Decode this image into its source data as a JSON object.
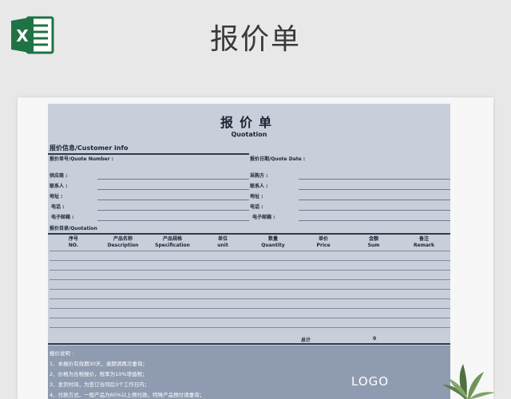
{
  "header": {
    "title": "报价单"
  },
  "doc": {
    "title": "报价单",
    "subtitle": "Quotation",
    "info_section": "报价信息/Customer info",
    "fields_left": [
      {
        "label": "报价单号/Quote Number :"
      },
      {
        "label": "供应商 :"
      },
      {
        "label": "联系人 :"
      },
      {
        "label": "地址 :"
      },
      {
        "label": "电话 :"
      },
      {
        "label": "电子邮箱 :"
      }
    ],
    "fields_right": [
      {
        "label": "报价日期/Quote Date :"
      },
      {
        "label": "采购方 :"
      },
      {
        "label": "联系人 :"
      },
      {
        "label": "地址 :"
      },
      {
        "label": "电话 :"
      },
      {
        "label": "电子邮箱 :"
      }
    ],
    "list_section": "报价目录/Quotation",
    "columns": [
      {
        "zh": "序号",
        "en": "NO."
      },
      {
        "zh": "产品名称",
        "en": "Description"
      },
      {
        "zh": "产品规格",
        "en": "Specification"
      },
      {
        "zh": "单位",
        "en": "unit"
      },
      {
        "zh": "数量",
        "en": "Quantity"
      },
      {
        "zh": "单价",
        "en": "Price"
      },
      {
        "zh": "金额",
        "en": "Sum"
      },
      {
        "zh": "备注",
        "en": "Remark"
      }
    ],
    "total_label": "总计",
    "total_value": "0",
    "notes_title": "报价说明 :",
    "notes": [
      "1、本报价有效期30天，逾期请再次垂询；",
      "2、价格为含税报价，税率为10%增值税；",
      "3、发货时间，为签订合同后3个工作日内；",
      "4、付款方式，一般产品为60%以上预付款，特殊产品预付请垂询；"
    ],
    "logo": "LOGO"
  },
  "colors": {
    "doc_background": "#c8cfdb",
    "notes_background": "#8e9bb0",
    "excel_green": "#1f7244"
  },
  "icons": {
    "app": "excel-icon",
    "decoration": "plant-icon"
  }
}
